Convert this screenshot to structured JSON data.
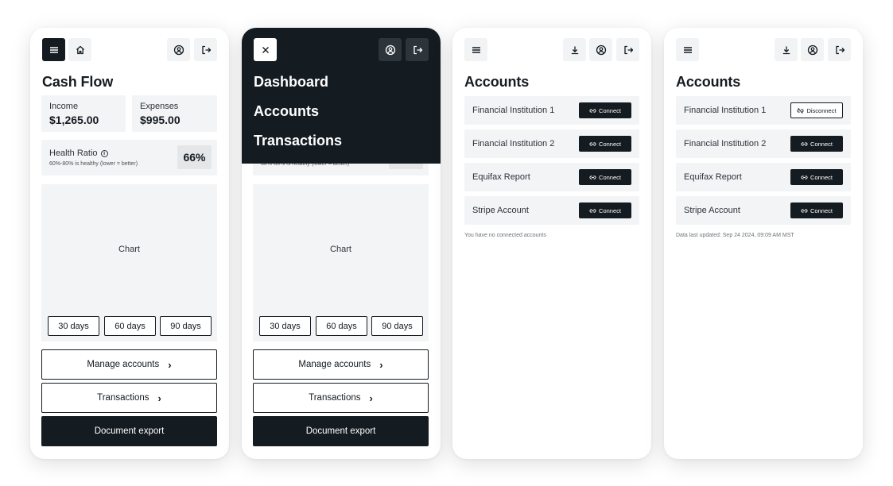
{
  "dashboard": {
    "title": "Cash Flow",
    "income_label": "Income",
    "income_value": "$1,265.00",
    "expenses_label": "Expenses",
    "expenses_value": "$995.00",
    "health_label": "Health Ratio",
    "health_info_glyph": "i",
    "health_hint": "60%-80% is healthy (lower = better)",
    "health_value": "66%",
    "chart_placeholder": "Chart",
    "ranges": [
      "30 days",
      "60 days",
      "90 days"
    ],
    "manage_accounts": "Manage accounts",
    "transactions": "Transactions",
    "chevron": "›",
    "document_export": "Document export"
  },
  "menu": {
    "items": [
      "Dashboard",
      "Accounts",
      "Transactions"
    ]
  },
  "accounts": {
    "title": "Accounts",
    "connect_label": "Connect",
    "disconnect_label": "Disconnect",
    "institutions": [
      "Financial Institution 1",
      "Financial Institution 2",
      "Equifax Report",
      "Stripe Account"
    ],
    "empty_note": "You have no connected accounts",
    "updated_note": "Data last updated: Sep 24 2024, 09:09 AM MST"
  },
  "icons": {
    "menu": "hamburger-icon",
    "home": "home-icon",
    "profile": "user-circle-icon",
    "logout": "logout-icon",
    "close": "close-icon",
    "download": "download-icon",
    "link": "link-icon",
    "unlink": "unlink-icon"
  },
  "colors": {
    "primary": "#141b21",
    "surface": "#f3f4f5",
    "text": "#2c3339"
  }
}
